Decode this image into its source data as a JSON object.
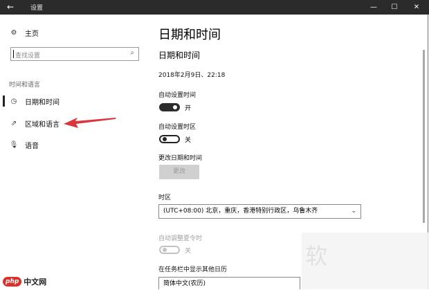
{
  "window": {
    "title": "设置",
    "back_icon": "back-arrow-icon",
    "minimize": "—",
    "maximize": "☐",
    "close": "✕"
  },
  "sidebar": {
    "home": "主页",
    "search_placeholder": "查找设置",
    "group": "时间和语言",
    "items": [
      {
        "label": "日期和时间",
        "icon": "calendar-clock-icon",
        "selected": true
      },
      {
        "label": "区域和语言",
        "icon": "region-icon",
        "selected": false
      },
      {
        "label": "语音",
        "icon": "microphone-icon",
        "selected": false
      }
    ]
  },
  "annotation": {
    "color": "#d9363e"
  },
  "main": {
    "page_title": "日期和时间",
    "section_title": "日期和时间",
    "current_datetime": "2018年2月9日、22:18",
    "auto_time_label": "自动设置时间",
    "auto_time_state": "开",
    "auto_zone_label": "自动设置时区",
    "auto_zone_state": "关",
    "change_label": "更改日期和时间",
    "change_button": "更改",
    "timezone_label": "时区",
    "timezone_value": "(UTC+08:00) 北京，重庆，香港特别行政区，乌鲁木齐",
    "dst_label": "自动调整夏令时",
    "dst_state": "关",
    "calendar_label": "在任务栏中显示其他日历",
    "calendar_value": "简体中文(农历)"
  },
  "watermark": {
    "char": "软",
    "logo_badge": "php",
    "logo_text": "中文网"
  }
}
